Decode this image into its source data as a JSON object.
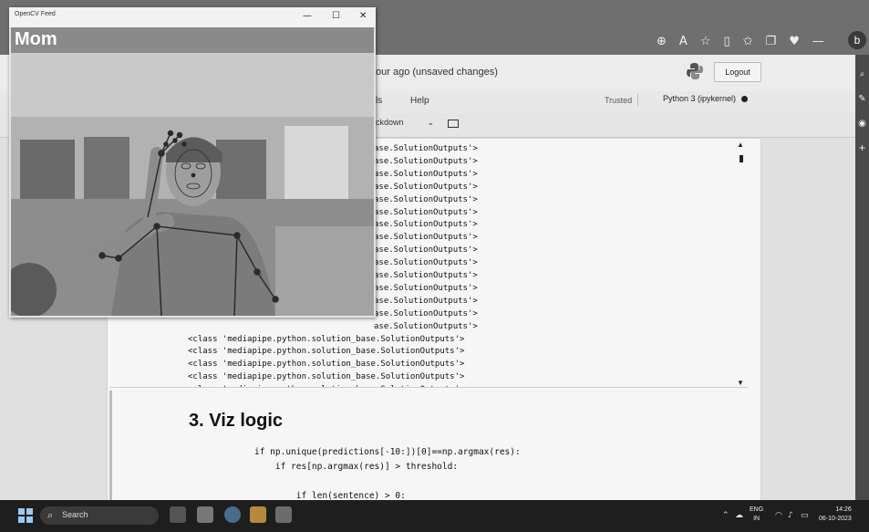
{
  "browser": {
    "toolbar_icons": [
      {
        "icon": "zoom-icon",
        "glyph": "⊕"
      },
      {
        "icon": "read-aloud-icon",
        "glyph": "A"
      },
      {
        "icon": "favorite-icon",
        "glyph": "☆"
      },
      {
        "icon": "split-screen-icon",
        "glyph": "▯"
      },
      {
        "icon": "favorites-bar-icon",
        "glyph": "✩"
      },
      {
        "icon": "collections-icon",
        "glyph": "❐"
      },
      {
        "icon": "heart-icon",
        "glyph": "♥"
      },
      {
        "icon": "minimize-icon",
        "glyph": "—"
      }
    ],
    "profile_initial": "b"
  },
  "jupyter": {
    "title_fragment": "our ago  (unsaved changes)",
    "logout_label": "Logout",
    "menu": {
      "cells_fragment": "ls",
      "help": "Help"
    },
    "trusted": "Trusted",
    "kernel": "Python 3 (ipykernel)",
    "cell_type": "ckdown",
    "output_lines_partial": [
      "ase.SolutionOutputs'>",
      "ase.SolutionOutputs'>",
      "ase.SolutionOutputs'>",
      "ase.SolutionOutputs'>",
      "ase.SolutionOutputs'>",
      "ase.SolutionOutputs'>",
      "ase.SolutionOutputs'>",
      "ase.SolutionOutputs'>",
      "ase.SolutionOutputs'>",
      "ase.SolutionOutputs'>",
      "ase.SolutionOutputs'>",
      "ase.SolutionOutputs'>",
      "ase.SolutionOutputs'>",
      "ase.SolutionOutputs'>",
      "ase.SolutionOutputs'>"
    ],
    "output_lines_full": [
      "<class 'mediapipe.python.solution_base.SolutionOutputs'>",
      "<class 'mediapipe.python.solution_base.SolutionOutputs'>",
      "<class 'mediapipe.python.solution_base.SolutionOutputs'>",
      "<class 'mediapipe.python.solution_base.SolutionOutputs'>",
      "<class 'mediapipe.python.solution_base.SolutionOutputs'>"
    ],
    "section_heading": "3. Viz logic",
    "code_lines": [
      "if np.unique(predictions[-10:])[0]==np.argmax(res):",
      "    if res[np.argmax(res)] > threshold:",
      "        if len(sentence) > 0:"
    ]
  },
  "opencv": {
    "window_title": "OpenCV Feed",
    "controls": {
      "minimize": "—",
      "maximize": "☐",
      "close": "✕"
    },
    "detected_label": "Mom"
  },
  "taskbar": {
    "search_label": "Search",
    "language": "ENG",
    "region": "IN",
    "time": "14:26",
    "date": "06-10-2023",
    "tray_icons": [
      "chevron-up-icon",
      "cloud-icon",
      "wifi-icon",
      "volume-icon",
      "battery-icon"
    ]
  },
  "colors": {
    "browser_chrome": "#6f6f6f",
    "taskbar": "#1e1e1e",
    "label_bar": "#8a8a8a",
    "landmark": "#2b2b2b"
  }
}
